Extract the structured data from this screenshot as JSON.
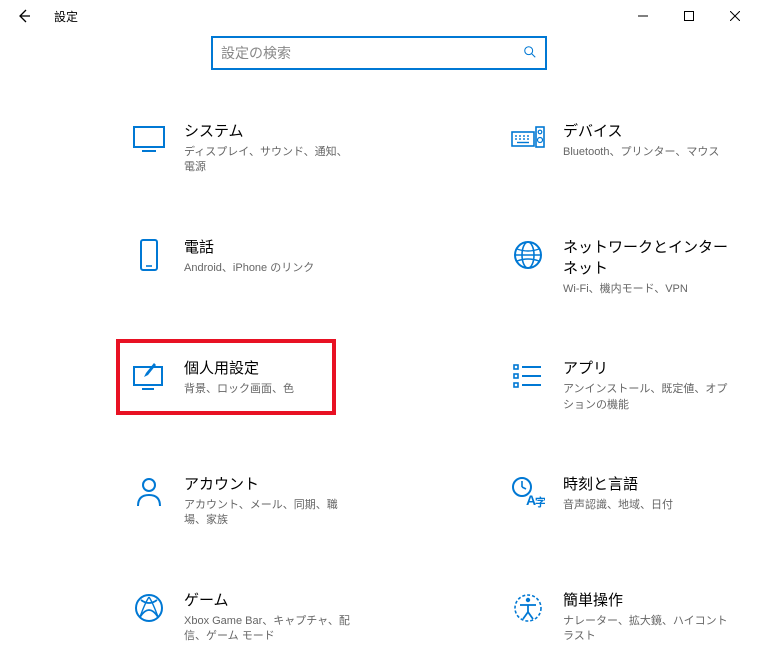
{
  "window": {
    "title": "設定"
  },
  "search": {
    "placeholder": "設定の検索"
  },
  "categories": {
    "system": {
      "title": "システム",
      "desc": "ディスプレイ、サウンド、通知、電源"
    },
    "devices": {
      "title": "デバイス",
      "desc": "Bluetooth、プリンター、マウス"
    },
    "phone": {
      "title": "電話",
      "desc": "Android、iPhone のリンク"
    },
    "network": {
      "title": "ネットワークとインターネット",
      "desc": "Wi-Fi、機内モード、VPN"
    },
    "personalization": {
      "title": "個人用設定",
      "desc": "背景、ロック画面、色"
    },
    "apps": {
      "title": "アプリ",
      "desc": "アンインストール、既定値、オプションの機能"
    },
    "accounts": {
      "title": "アカウント",
      "desc": "アカウント、メール、同期、職場、家族"
    },
    "time": {
      "title": "時刻と言語",
      "desc": "音声認識、地域、日付"
    },
    "gaming": {
      "title": "ゲーム",
      "desc": "Xbox Game Bar、キャプチャ、配信、ゲーム モード"
    },
    "ease": {
      "title": "簡単操作",
      "desc": "ナレーター、拡大鏡、ハイコントラスト"
    }
  }
}
